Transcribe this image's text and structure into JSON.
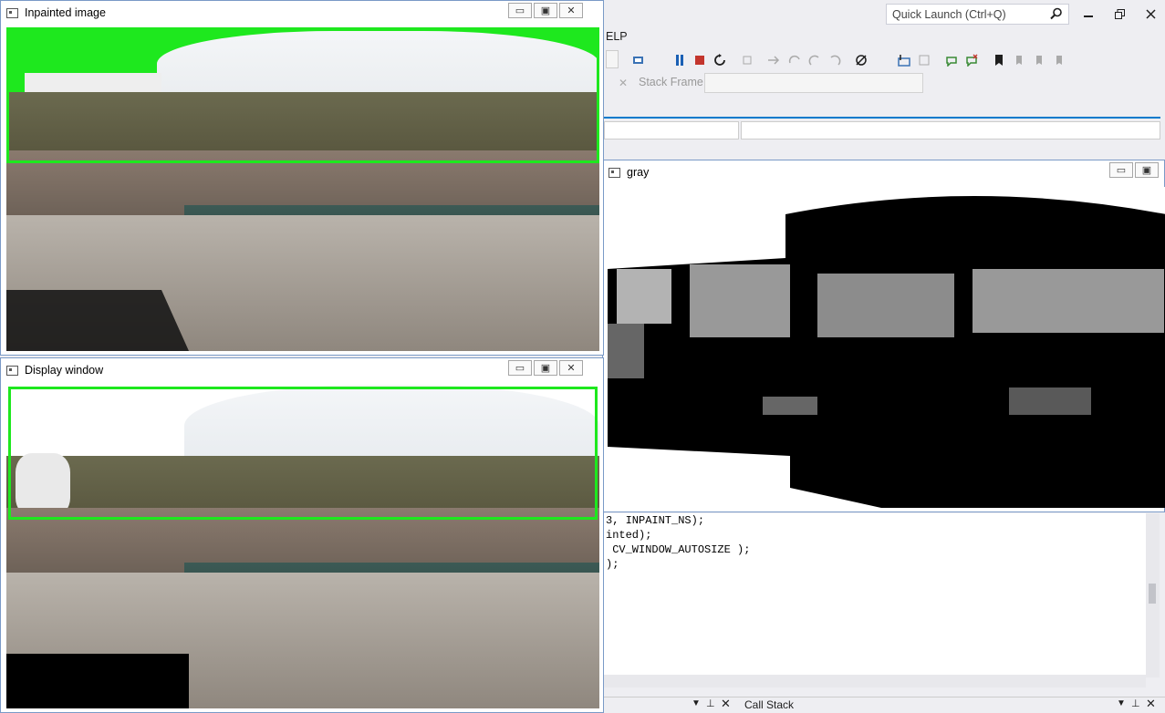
{
  "vs": {
    "quick_launch_placeholder": "Quick Launch (Ctrl+Q)",
    "menu_partial": "ELP",
    "stack_frame_label": "Stack Frame:",
    "code_lines": [
      "3, INPAINT_NS);",
      "inted);",
      " CV_WINDOW_AUTOSIZE );",
      ");"
    ],
    "bottom_tab": "Call Stack",
    "icons": [
      "search-icon",
      "minimize-icon",
      "restore-icon",
      "close-icon",
      "pause-icon",
      "stop-icon",
      "restart-icon"
    ]
  },
  "windows": {
    "inpainted": {
      "title": "Inpainted image"
    },
    "display": {
      "title": "Display window"
    },
    "gray": {
      "title": "gray"
    }
  },
  "colors": {
    "accent": "#007acc",
    "selection_box": "#1ee81e",
    "stop": "#c3352d",
    "pause": "#1a5fb4"
  }
}
